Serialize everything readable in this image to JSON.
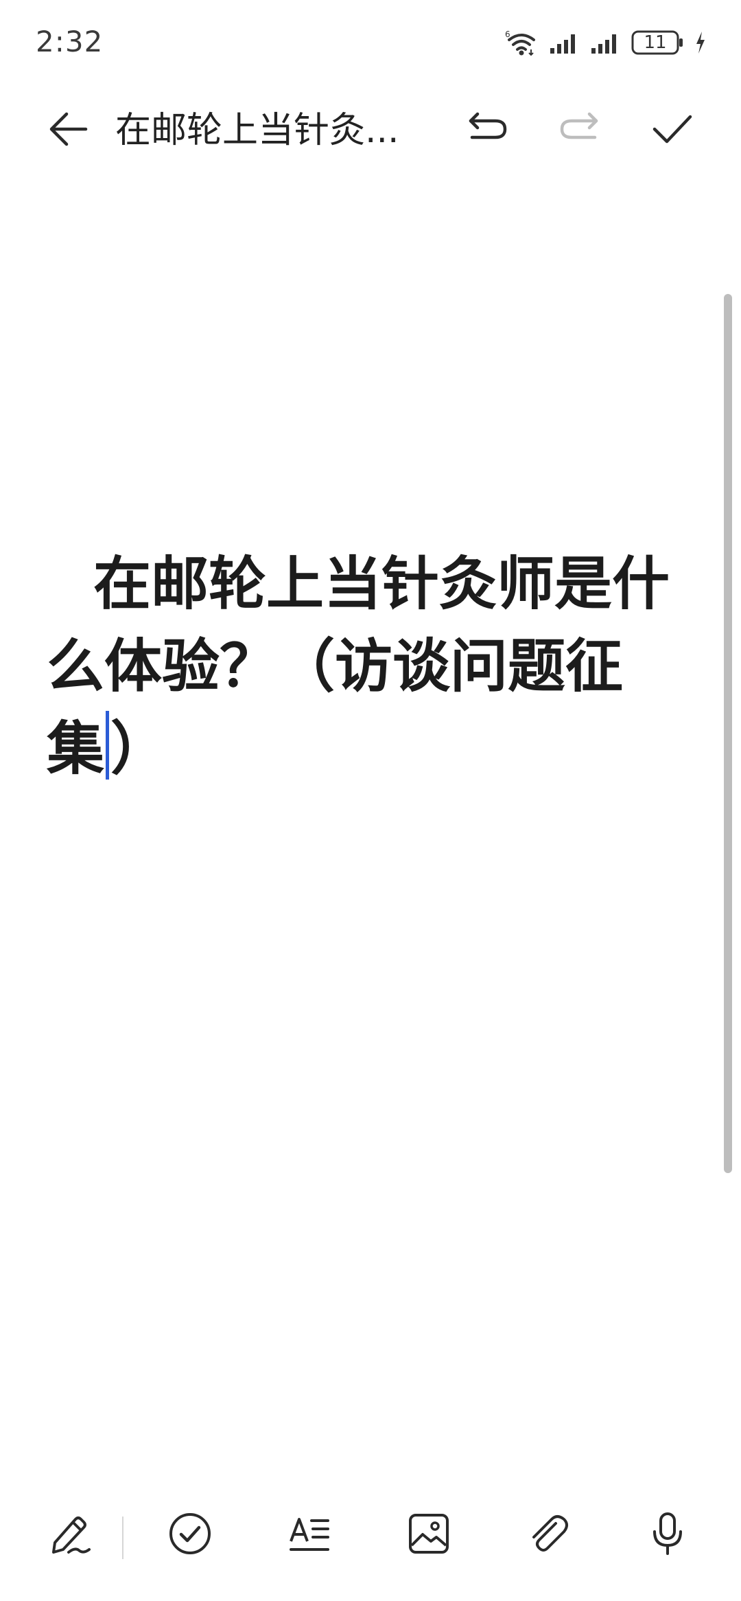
{
  "status_bar": {
    "time": "2:32",
    "battery": "11",
    "icons": [
      "wifi-icon",
      "signal-icon",
      "signal-icon",
      "battery-icon",
      "charging-icon"
    ]
  },
  "app_bar": {
    "title": "在邮轮上当针灸...",
    "icons": [
      "back-arrow-icon",
      "undo-icon",
      "redo-icon",
      "check-icon"
    ]
  },
  "editor": {
    "text_before_caret": "在邮轮上当针灸师是什么体验？（访谈问题征集",
    "text_after_caret": "）"
  },
  "toolbar": {
    "icons": [
      "pen-icon",
      "checklist-icon",
      "text-format-icon",
      "image-icon",
      "attachment-icon",
      "microphone-icon"
    ]
  },
  "colors": {
    "caret": "#2b5cd6",
    "text": "#1c1c1c",
    "disabled_icon": "#bdbdbd",
    "scrollbar": "#bdbdbd"
  }
}
